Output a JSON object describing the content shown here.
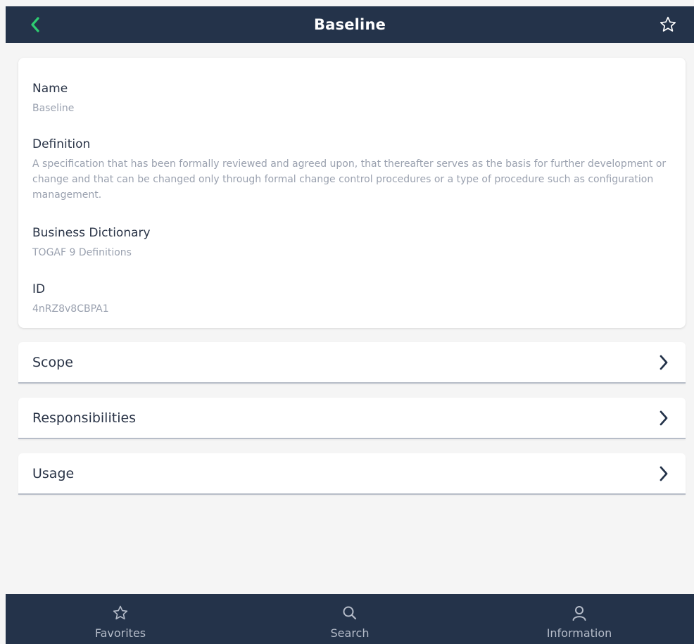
{
  "header": {
    "title": "Baseline",
    "back_icon": "chevron-left-icon",
    "favorite_icon": "star-outline-icon"
  },
  "details": {
    "name_label": "Name",
    "name_value": "Baseline",
    "definition_label": "Definition",
    "definition_value": "A specification that has been formally reviewed and agreed upon, that thereafter serves as the basis for further development or change and that can be changed only through formal change control procedures or a type of procedure such as configuration management.",
    "dictionary_label": "Business Dictionary",
    "dictionary_value": "TOGAF 9 Definitions",
    "id_label": "ID",
    "id_value": "4nRZ8v8CBPA1"
  },
  "sections": [
    {
      "label": "Scope"
    },
    {
      "label": "Responsibilities"
    },
    {
      "label": "Usage"
    }
  ],
  "bottom_nav": [
    {
      "label": "Favorites",
      "icon": "star-outline-icon"
    },
    {
      "label": "Search",
      "icon": "search-icon"
    },
    {
      "label": "Information",
      "icon": "user-icon"
    }
  ],
  "colors": {
    "bar_background": "#24334a",
    "back_accent": "#2ecc71",
    "label_text": "#2a3447",
    "value_text": "#9aa1af",
    "page_background": "#f5f5f5"
  }
}
